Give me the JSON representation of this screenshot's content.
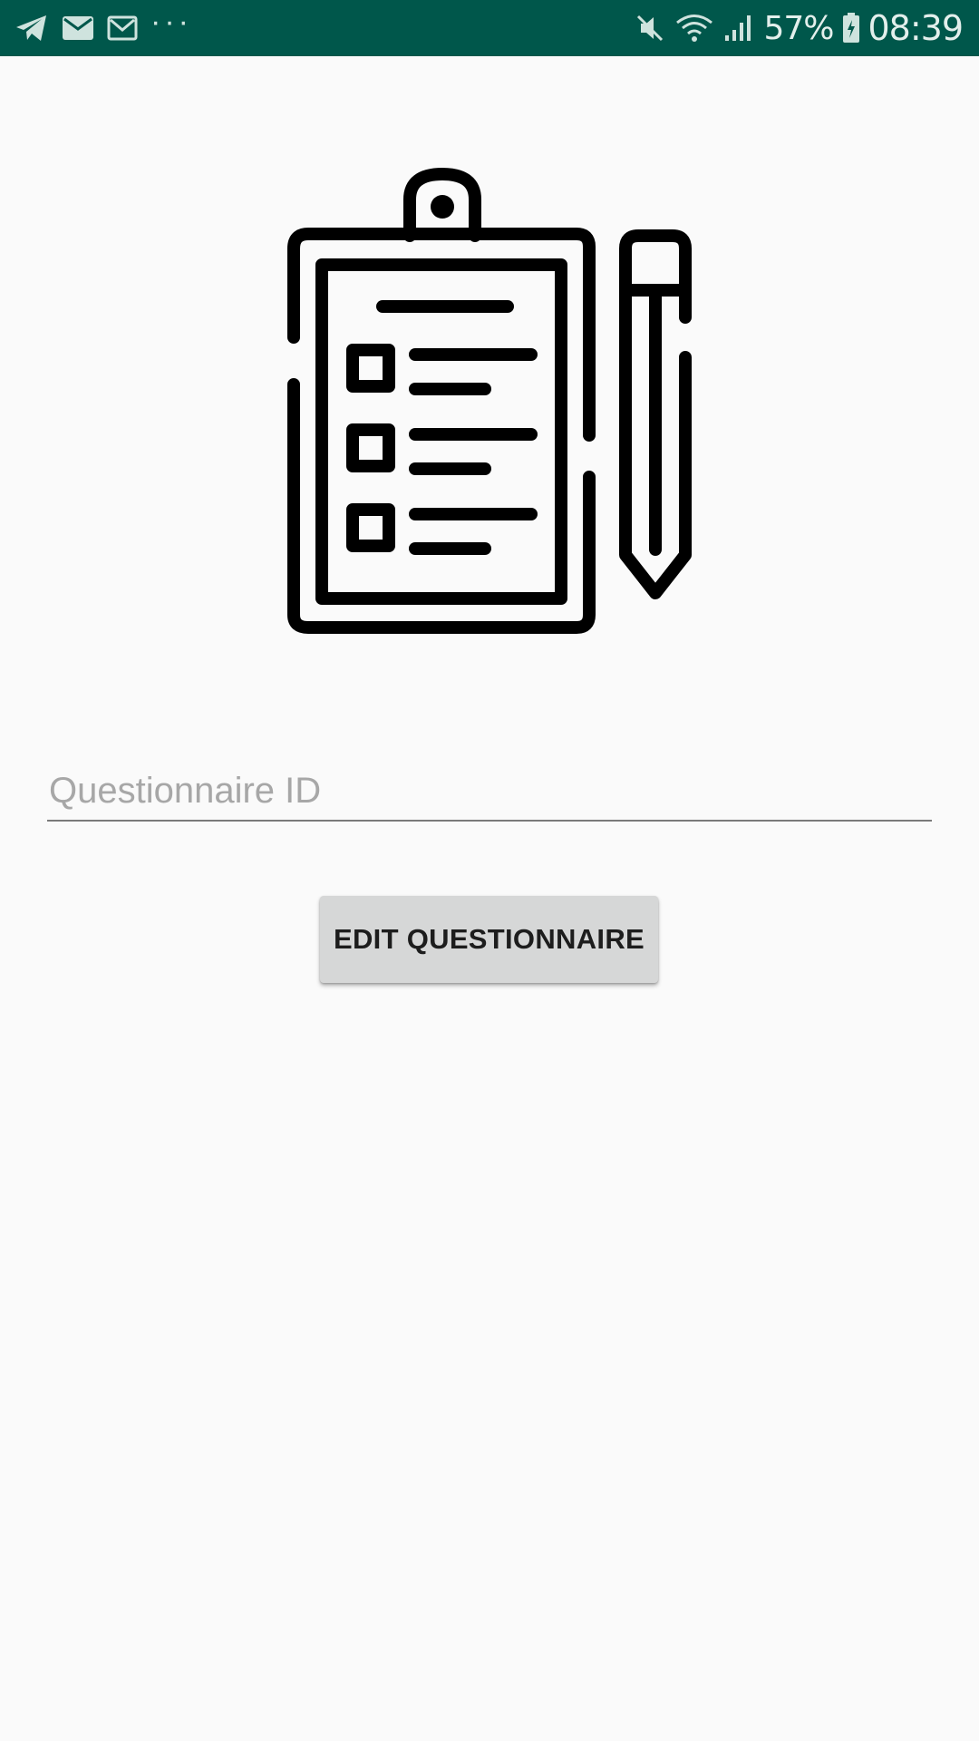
{
  "status_bar": {
    "battery": "57%",
    "time": "08:39",
    "notification_icons": [
      "telegram-icon",
      "mail-icon",
      "gmail-icon",
      "more-dots-icon"
    ],
    "system_icons": [
      "mute-icon",
      "wifi-icon",
      "signal-icon",
      "battery-charging-icon"
    ],
    "more_dots": "···",
    "background_color": "#00574b"
  },
  "illustration": {
    "icon": "clipboard-checklist-pencil-icon"
  },
  "form": {
    "questionnaire_id": {
      "placeholder": "Questionnaire ID",
      "value": ""
    },
    "edit_button_label": "EDIT QUESTIONNAIRE"
  },
  "colors": {
    "page_background": "#fafafa",
    "button_background": "#d6d7d7",
    "underline": "#7a7a7a"
  }
}
